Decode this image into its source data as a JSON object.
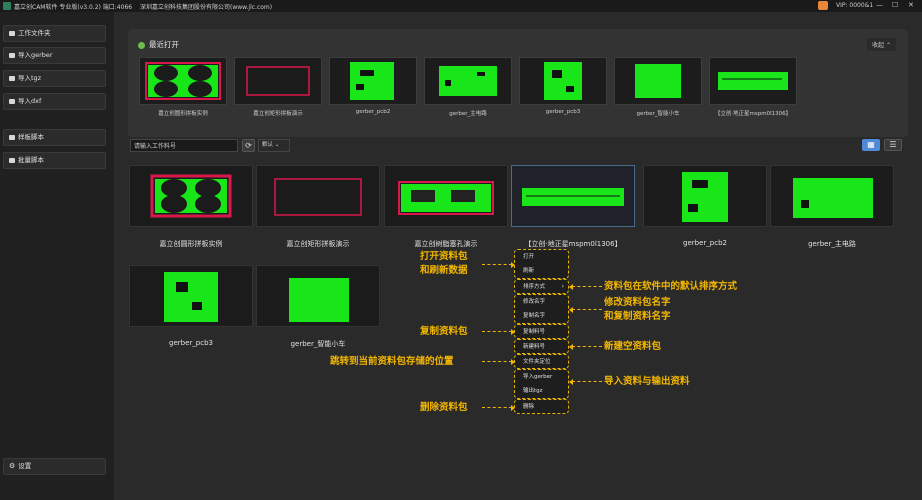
{
  "titlebar": {
    "title": "嘉立创CAM软件 专业版(v3.0.2) 端口:4066",
    "company": "深圳嘉立创科技集团股份有限公司(www.jlc.com)",
    "vip": "VIP: 0000&1",
    "controls": [
      "—",
      "☐",
      "✕"
    ]
  },
  "sidebar": {
    "items": [
      {
        "label": "工作文件夹",
        "icon": "folder-icon"
      },
      {
        "label": "导入gerber",
        "icon": "folder-icon"
      },
      {
        "label": "导入tgz",
        "icon": "folder-icon"
      },
      {
        "label": "导入dxf",
        "icon": "folder-icon"
      },
      {
        "label": "样板脚本",
        "icon": "folder-icon"
      },
      {
        "label": "批量脚本",
        "icon": "folder-icon"
      }
    ],
    "settings": {
      "label": "设置",
      "icon": "gear-icon"
    }
  },
  "recent": {
    "title": "最近打开",
    "collapse": "收起 ⌃",
    "items": [
      {
        "label": "嘉立创圆形拼板实例",
        "thumb": "circles"
      },
      {
        "label": "嘉立创矩形拼板演示",
        "thumb": "rect"
      },
      {
        "label": "gerber_pcb2",
        "thumb": "pcb2"
      },
      {
        "label": "gerber_主电路",
        "thumb": "main"
      },
      {
        "label": "gerber_pcb3",
        "thumb": "pcb3"
      },
      {
        "label": "gerber_智能小车",
        "thumb": "car"
      },
      {
        "label": "【立创·地正星mspm0l1306】",
        "thumb": "strip"
      }
    ]
  },
  "toolbar": {
    "search_value": "请输入工作料号",
    "refresh": "⟳",
    "sort": "默认 ⌄",
    "grid_view": "▦",
    "list_view": "☰"
  },
  "cards": [
    {
      "label": "嘉立创圆形拼板实例",
      "thumb": "circles"
    },
    {
      "label": "嘉立创矩形拼板演示",
      "thumb": "rect"
    },
    {
      "label": "嘉立创树脂塞孔演示",
      "thumb": "resin"
    },
    {
      "label": "【立创·地正星mspm0l1306】",
      "thumb": "strip"
    },
    {
      "label": "gerber_pcb2",
      "thumb": "pcb2"
    },
    {
      "label": "gerber_主电路",
      "thumb": "main"
    },
    {
      "label": "gerber_pcb3",
      "thumb": "pcb3"
    },
    {
      "label": "gerber_智能小车",
      "thumb": "car"
    }
  ],
  "menu": {
    "open": "打开",
    "refresh": "刷新",
    "sort": "排序方式",
    "rename": "修改名字",
    "copy_name": "复制名字",
    "copy_pkg": "复制料号",
    "new_pkg": "新建料号",
    "locate": "文件夹定位",
    "import_gerber": "导入gerber",
    "export_tgz": "输出tgz",
    "delete": "删除"
  },
  "annotations": {
    "open_refresh": "打开资料包\n和刷新数据",
    "sort": "资料包在软件中的默认排序方式",
    "rename": "修改资料包名字\n和复制资料名字",
    "copy": "复制资料包",
    "new": "新建空资料包",
    "locate": "跳转到当前资料包存储的位置",
    "import_export": "导入资料与输出资料",
    "delete": "删除资料包"
  },
  "colors": {
    "pcb_green": "#19e619",
    "pcb_red": "#d8184a",
    "annotation": "#f2b600",
    "accent_blue": "#4f8ad6"
  }
}
